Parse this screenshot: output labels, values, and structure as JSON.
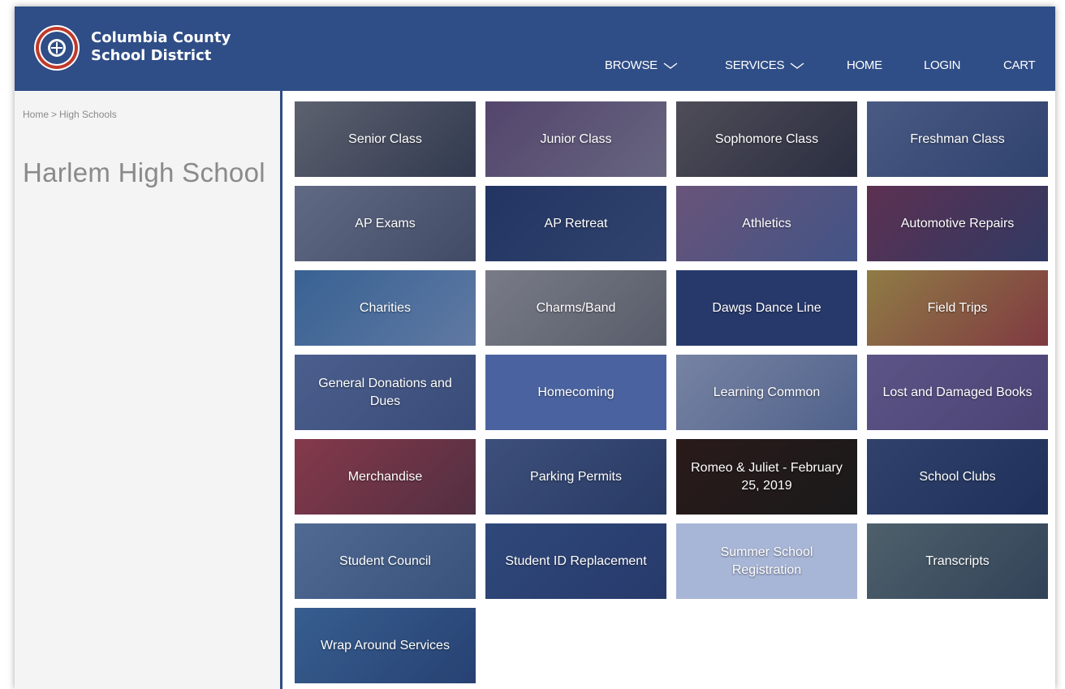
{
  "header": {
    "brand_line1": "Columbia County",
    "brand_line2": "School District",
    "nav": {
      "browse": "BROWSE",
      "services": "SERVICES",
      "home": "HOME",
      "login": "LOGIN",
      "cart": "CART"
    }
  },
  "sidebar": {
    "breadcrumb_home": "Home",
    "breadcrumb_sep": ">",
    "breadcrumb_current": "High Schools",
    "page_title": "Harlem High School"
  },
  "tiles": [
    {
      "label": "Senior Class"
    },
    {
      "label": "Junior Class"
    },
    {
      "label": "Sophomore Class"
    },
    {
      "label": "Freshman Class"
    },
    {
      "label": "AP Exams"
    },
    {
      "label": "AP Retreat"
    },
    {
      "label": "Athletics"
    },
    {
      "label": "Automotive Repairs"
    },
    {
      "label": "Charities"
    },
    {
      "label": "Charms/Band"
    },
    {
      "label": "Dawgs Dance Line"
    },
    {
      "label": "Field Trips"
    },
    {
      "label": "General Donations and Dues"
    },
    {
      "label": "Homecoming"
    },
    {
      "label": "Learning Common"
    },
    {
      "label": "Lost and Damaged Books"
    },
    {
      "label": "Merchandise"
    },
    {
      "label": "Parking Permits"
    },
    {
      "label": "Romeo & Juliet - February 25, 2019"
    },
    {
      "label": "School Clubs"
    },
    {
      "label": "Student Council"
    },
    {
      "label": "Student ID Replacement"
    },
    {
      "label": "Summer School Registration"
    },
    {
      "label": "Transcripts"
    },
    {
      "label": "Wrap Around Services"
    }
  ],
  "colors": {
    "header_bg": "#2f4d86",
    "accent": "#2f4d86",
    "sidebar_bg": "#f4f4f4",
    "muted_text": "#8a8a8a"
  }
}
